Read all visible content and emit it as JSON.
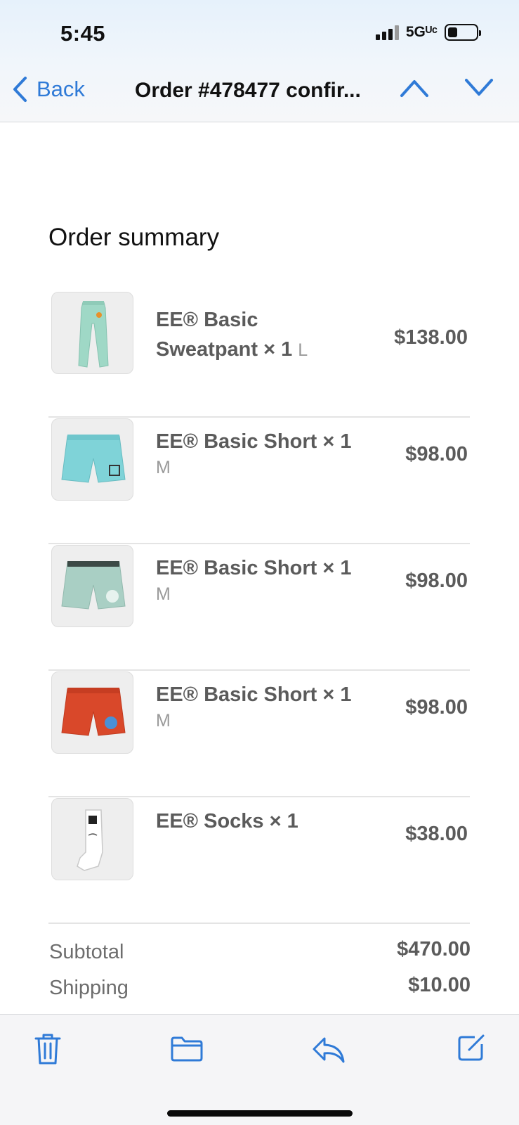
{
  "status_bar": {
    "time": "5:45",
    "network": "5Gᵁᶜ"
  },
  "nav": {
    "back_label": "Back",
    "title": "Order #478477 confir..."
  },
  "summary": {
    "title": "Order summary"
  },
  "items": [
    {
      "name_line1": "EE® Basic",
      "name_line2": "Sweatpant × 1",
      "variant": "L",
      "price": "$138.00",
      "thumb_icon": "sweatpant-icon"
    },
    {
      "name": "EE® Basic Short × 1",
      "variant": "M",
      "price": "$98.00",
      "thumb_icon": "short-icon"
    },
    {
      "name": "EE® Basic Short × 1",
      "variant": "M",
      "price": "$98.00",
      "thumb_icon": "short-icon"
    },
    {
      "name": "EE® Basic Short × 1",
      "variant": "M",
      "price": "$98.00",
      "thumb_icon": "short-icon"
    },
    {
      "name": "EE® Socks × 1",
      "variant": "",
      "price": "$38.00",
      "thumb_icon": "socks-icon"
    }
  ],
  "totals": {
    "subtotal_label": "Subtotal",
    "subtotal_value": "$470.00",
    "shipping_label": "Shipping",
    "shipping_value": "$10.00"
  },
  "toolbar": {
    "icons": [
      "trash-icon",
      "folder-icon",
      "reply-icon",
      "compose-icon"
    ]
  },
  "colors": {
    "accent": "#2f7ad7",
    "item_text": "#5b5b5b",
    "variant_text": "#9a9a9a"
  }
}
